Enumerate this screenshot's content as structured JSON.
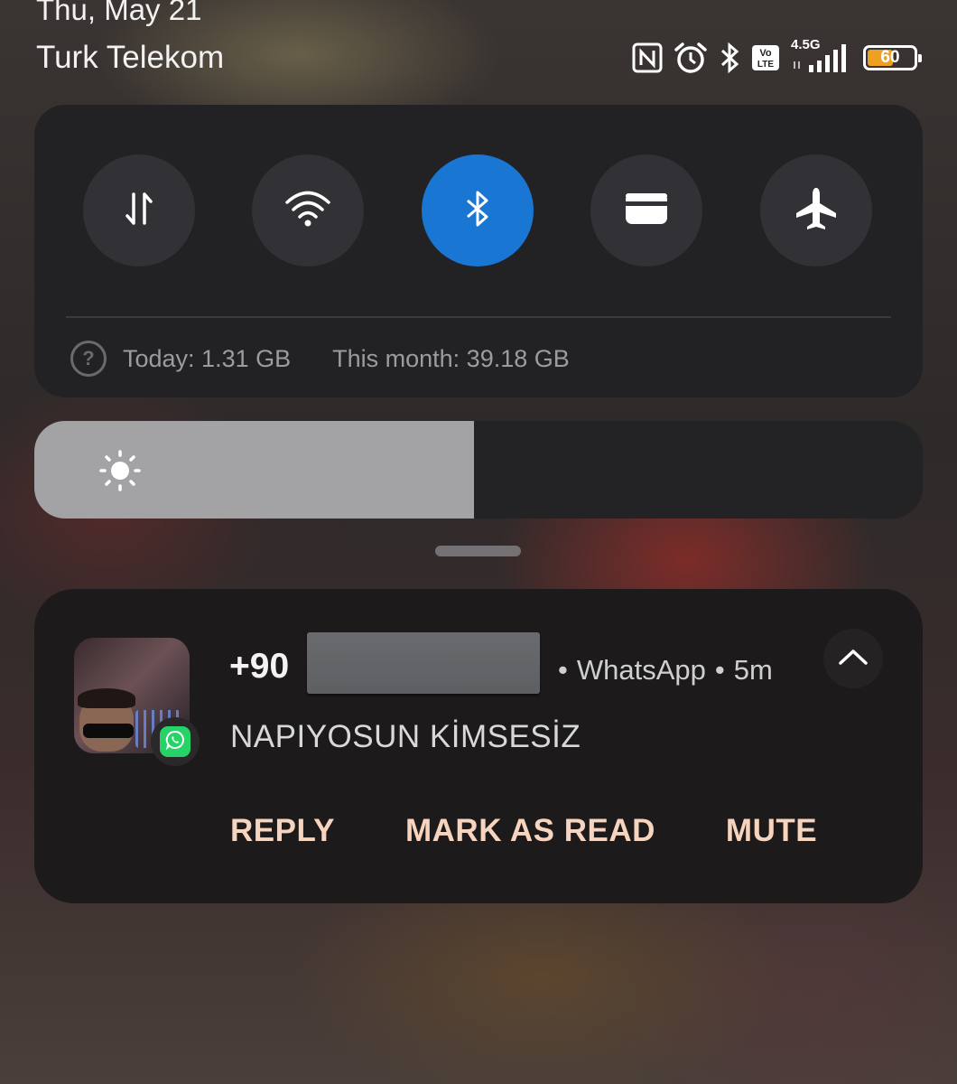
{
  "status_bar": {
    "date": "Thu, May 21",
    "carrier": "Turk Telekom",
    "icons": [
      "nfc-icon",
      "alarm-icon",
      "bluetooth-icon",
      "volte-icon",
      "signal-icon",
      "battery-icon"
    ],
    "network": "4.5G",
    "volte": [
      "Vo",
      "LTE"
    ],
    "battery_percent": "60",
    "battery_level": 0.6
  },
  "quick_settings": {
    "toggles": [
      {
        "name": "mobile-data",
        "icon": "data-transfer-icon",
        "on": true
      },
      {
        "name": "wifi",
        "icon": "wifi-icon",
        "on": false
      },
      {
        "name": "bluetooth",
        "icon": "bluetooth-icon",
        "on": true
      },
      {
        "name": "card",
        "icon": "card-icon",
        "on": false
      },
      {
        "name": "airplane-mode",
        "icon": "airplane-icon",
        "on": false
      }
    ],
    "data_usage": {
      "today": "Today: 1.31 GB",
      "month": "This month: 39.18 GB",
      "help_symbol": "?"
    }
  },
  "brightness": {
    "level": 0.495,
    "icon": "sun-icon"
  },
  "notification": {
    "sender": "+90",
    "app": "WhatsApp",
    "separator": "•",
    "time": "5m",
    "message": "NAPIYOSUN KİMSESİZ",
    "actions": [
      "REPLY",
      "MARK AS READ",
      "MUTE"
    ]
  },
  "colors": {
    "accent_on": "#1976d2",
    "toggle_off": "#323236",
    "action_text": "#f6d4bd",
    "whatsapp": "#25d366",
    "battery": "#f0a020"
  }
}
